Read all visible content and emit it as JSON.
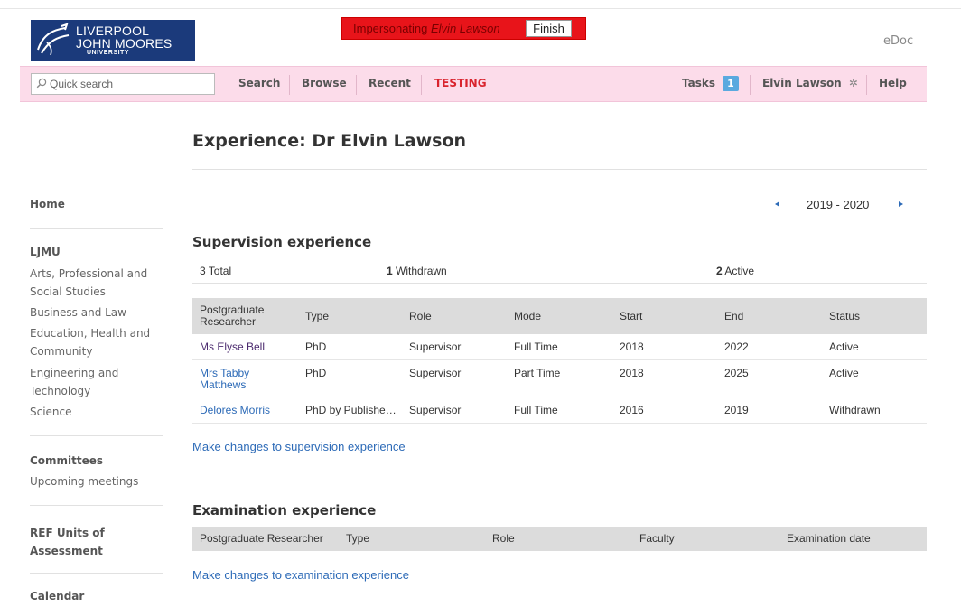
{
  "logo": {
    "line1": "LIVERPOOL",
    "line2": "JOHN MOORES",
    "line3": "UNIVERSITY"
  },
  "impersonation": {
    "prefix": "Impersonating ",
    "name": "Elvin Lawson",
    "finish_label": "Finish"
  },
  "app_name": "eDoc",
  "nav": {
    "search_placeholder": "Quick search",
    "items": [
      "Search",
      "Browse",
      "Recent",
      "TESTING"
    ],
    "tasks_label": "Tasks",
    "tasks_count": "1",
    "user_label": "Elvin Lawson",
    "help_label": "Help"
  },
  "sidebar": {
    "home": "Home",
    "ljmu_heading": "LJMU",
    "faculties": [
      "Arts, Professional and Social Studies",
      "Business and Law",
      "Education, Health and Community",
      "Engineering and Technology",
      "Science"
    ],
    "committees_heading": "Committees",
    "upcoming_meetings": "Upcoming meetings",
    "ref_heading": "REF Units of Assessment",
    "calendar_heading": "Calendar"
  },
  "page": {
    "title": "Experience: Dr Elvin Lawson",
    "year_range": "2019 - 2020"
  },
  "supervision": {
    "title": "Supervision experience",
    "summary": {
      "total": "3 Total",
      "withdrawn_count": "1",
      "withdrawn_label": " Withdrawn",
      "active_count": "2",
      "active_label": " Active"
    },
    "columns": [
      "Postgraduate Researcher",
      "Type",
      "Role",
      "Mode",
      "Start",
      "End",
      "Status"
    ],
    "rows": [
      {
        "researcher": "Ms Elyse Bell",
        "type": "PhD",
        "role": "Supervisor",
        "mode": "Full Time",
        "start": "2018",
        "end": "2022",
        "status": "Active"
      },
      {
        "researcher": "Mrs Tabby Matthews",
        "type": "PhD",
        "role": "Supervisor",
        "mode": "Part Time",
        "start": "2018",
        "end": "2025",
        "status": "Active"
      },
      {
        "researcher": "Delores Morris",
        "type": "PhD by Publishe…",
        "role": "Supervisor",
        "mode": "Full Time",
        "start": "2016",
        "end": "2019",
        "status": "Withdrawn"
      }
    ],
    "change_link": "Make changes to supervision experience"
  },
  "examination": {
    "title": "Examination experience",
    "columns": [
      "Postgraduate Researcher",
      "Type",
      "Role",
      "Faculty",
      "Examination date"
    ],
    "change_link": "Make changes to examination experience"
  },
  "colors": {
    "accent": "#2c6ab7",
    "nav_bg": "#fcdcea",
    "impersonate_bg": "#e8141a",
    "testing": "#d9232d",
    "logo_bg": "#1b3a7b"
  }
}
